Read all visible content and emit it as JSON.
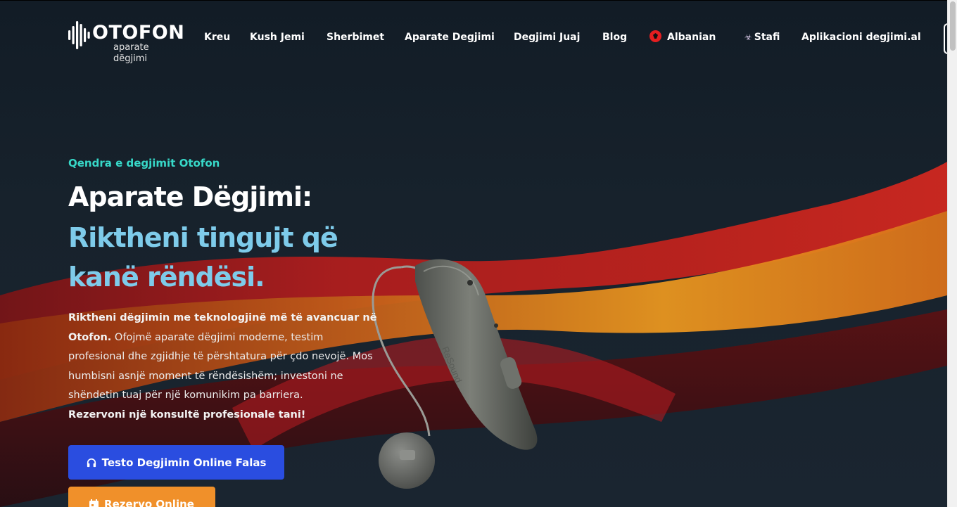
{
  "brand": {
    "name": "OTOFON",
    "tagline": "aparate dëgjimi"
  },
  "nav": {
    "items": [
      {
        "label": "Kreu"
      },
      {
        "label": "Kush Jemi"
      },
      {
        "label": "Sherbimet"
      },
      {
        "label": "Aparate Degjimi"
      },
      {
        "label": "Degjimi Juaj"
      },
      {
        "label": "Blog"
      },
      {
        "label": "Albanian",
        "icon": "albanian-flag-icon"
      },
      {
        "label": "Stafi",
        "icon": "staff-icon"
      },
      {
        "label": "Aplikacioni degjimi.al"
      }
    ]
  },
  "hero": {
    "eyebrow": "Qendra e degjimit Otofon",
    "title_line1": "Aparate Dëgjimi:",
    "title_line2": "Riktheni tingujt që kanë rëndësi.",
    "paragraph_bold_1": "Riktheni dëgjimin me teknologjinë më të avancuar në Otofon.",
    "paragraph_body": " Ofojmë aparate dëgjimi moderne, testim profesional dhe zgjidhje të përshtatura për çdo nevojë. Mos humbisni asnjë moment të rëndësishëm; investoni ne shëndetin tuaj për një komunikim pa barriera.",
    "paragraph_bold_2": "Rezervoni një konsultë profesionale tani!",
    "device_brand": "ReSound"
  },
  "buttons": {
    "test_label": "Testo Degjimin Online Falas",
    "test_icon": "headphones-icon",
    "reserve_label": "Rezervo Online",
    "reserve_icon": "calendar-icon"
  },
  "colors": {
    "background": "#17222c",
    "accent_teal": "#37d8c8",
    "accent_light_blue": "#7ecbea",
    "button_blue": "#2a4de0",
    "button_orange": "#f0902a",
    "flag_red": "#e41e20"
  }
}
